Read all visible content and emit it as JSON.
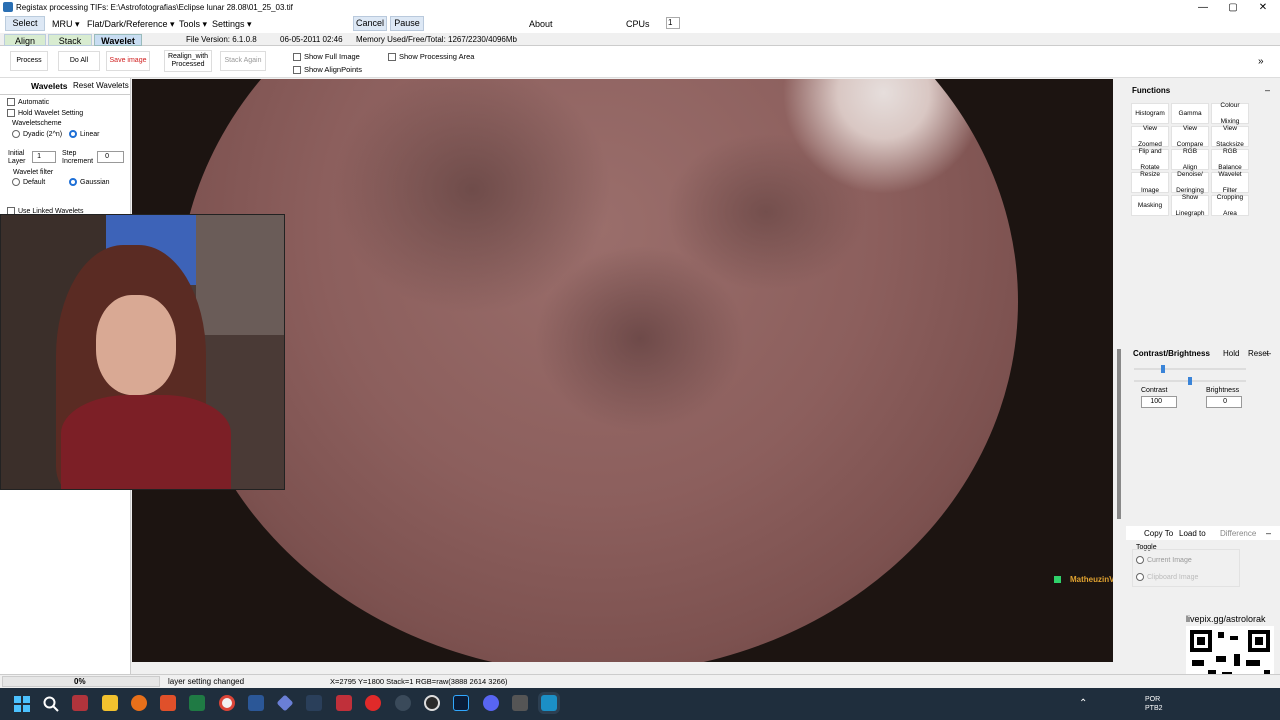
{
  "window": {
    "title": "Registax processing TIFs: E:\\Astrofotografias\\Eclipse lunar 28.08\\01_25_03.tif",
    "min": "—",
    "max": "▢",
    "close": "✕"
  },
  "menu": {
    "select": "Select",
    "mru": "MRU ▾",
    "flat": "Flat/Dark/Reference ▾",
    "tools": "Tools ▾",
    "settings": "Settings ▾",
    "cancel": "Cancel",
    "pause": "Pause",
    "about": "About",
    "cpus_label": "CPUs",
    "cpus_value": "1"
  },
  "tabs": {
    "align": "Align",
    "stack": "Stack",
    "wavelet": "Wavelet"
  },
  "info": {
    "file_version": "File Version: 6.1.0.8",
    "date": "06-05-2011 02:46",
    "memory": "Memory Used/Free/Total: 1267/2230/4096Mb"
  },
  "toolbar": {
    "process": "Process",
    "do_all": "Do All",
    "save_image": "Save image",
    "realign_1": "Realign_with",
    "realign_2": "Processed",
    "stack_again": "Stack Again",
    "show_full": "Show Full Image",
    "show_alignpoints": "Show AlignPoints",
    "show_processing": "Show Processing Area",
    "expand": "»"
  },
  "left": {
    "wavelets": "Wavelets",
    "reset_wavelets": "Reset Wavelets",
    "automatic": "Automatic",
    "hold": "Hold Wavelet Setting",
    "scheme": "Waveletscheme",
    "dyadic": "Dyadic (2^n)",
    "linear": "Linear",
    "initial_1": "Initial",
    "initial_2": "Layer",
    "initial_val": "1",
    "step_1": "Step",
    "step_2": "Increment",
    "step_val": "0",
    "filter": "Wavelet filter",
    "default": "Default",
    "gaussian": "Gaussian",
    "use_linked": "Use Linked Wavelets"
  },
  "functions": {
    "title": "Functions",
    "collapse": "–",
    "buttons": [
      [
        "Histogram"
      ],
      [
        "Gamma"
      ],
      [
        "Colour",
        "Mixing"
      ],
      [
        "View",
        "Zoomed"
      ],
      [
        "View",
        "Compare"
      ],
      [
        "View",
        "Stacksize"
      ],
      [
        "Flip and",
        "Rotate"
      ],
      [
        "RGB",
        "Align"
      ],
      [
        "RGB",
        "Balance"
      ],
      [
        "Resize",
        "Image"
      ],
      [
        "Denoise/",
        "Deringing"
      ],
      [
        "Wavelet",
        "Filter"
      ],
      [
        "Masking"
      ],
      [
        "Show",
        "Linegraph"
      ],
      [
        "Cropping",
        "Area"
      ]
    ]
  },
  "contrast": {
    "title": "Contrast/Brightness",
    "hold": "Hold",
    "reset": "Reset",
    "collapse": "–",
    "contrast_label": "Contrast",
    "contrast_val": "100",
    "brightness_label": "Brightness",
    "brightness_val": "0",
    "contrast_pos": 0.25,
    "brightness_pos": 0.5
  },
  "copy": {
    "copy_to": "Copy To",
    "load_to": "Load to",
    "difference": "Difference",
    "collapse": "–",
    "toggle": "Toggle",
    "current": "Current Image",
    "clipboard": "Clipboard Image"
  },
  "overlay": {
    "chat_user": "MatheuzinVida",
    "livepix": "livepix.gg/astrolorak"
  },
  "status": {
    "progress": "0%",
    "progress_value": 0,
    "message": "layer setting changed",
    "coords": "X=2795 Y=1800 Stack=1 RGB=raw(3888 2614 3266)"
  },
  "taskbar": {
    "lang1": "POR",
    "lang2": "PTB2"
  },
  "colors": {
    "accent": "#1e6fd6",
    "moon": "#8c5f5d",
    "taskbar": "#1f2e3d",
    "save": "#d02020"
  }
}
